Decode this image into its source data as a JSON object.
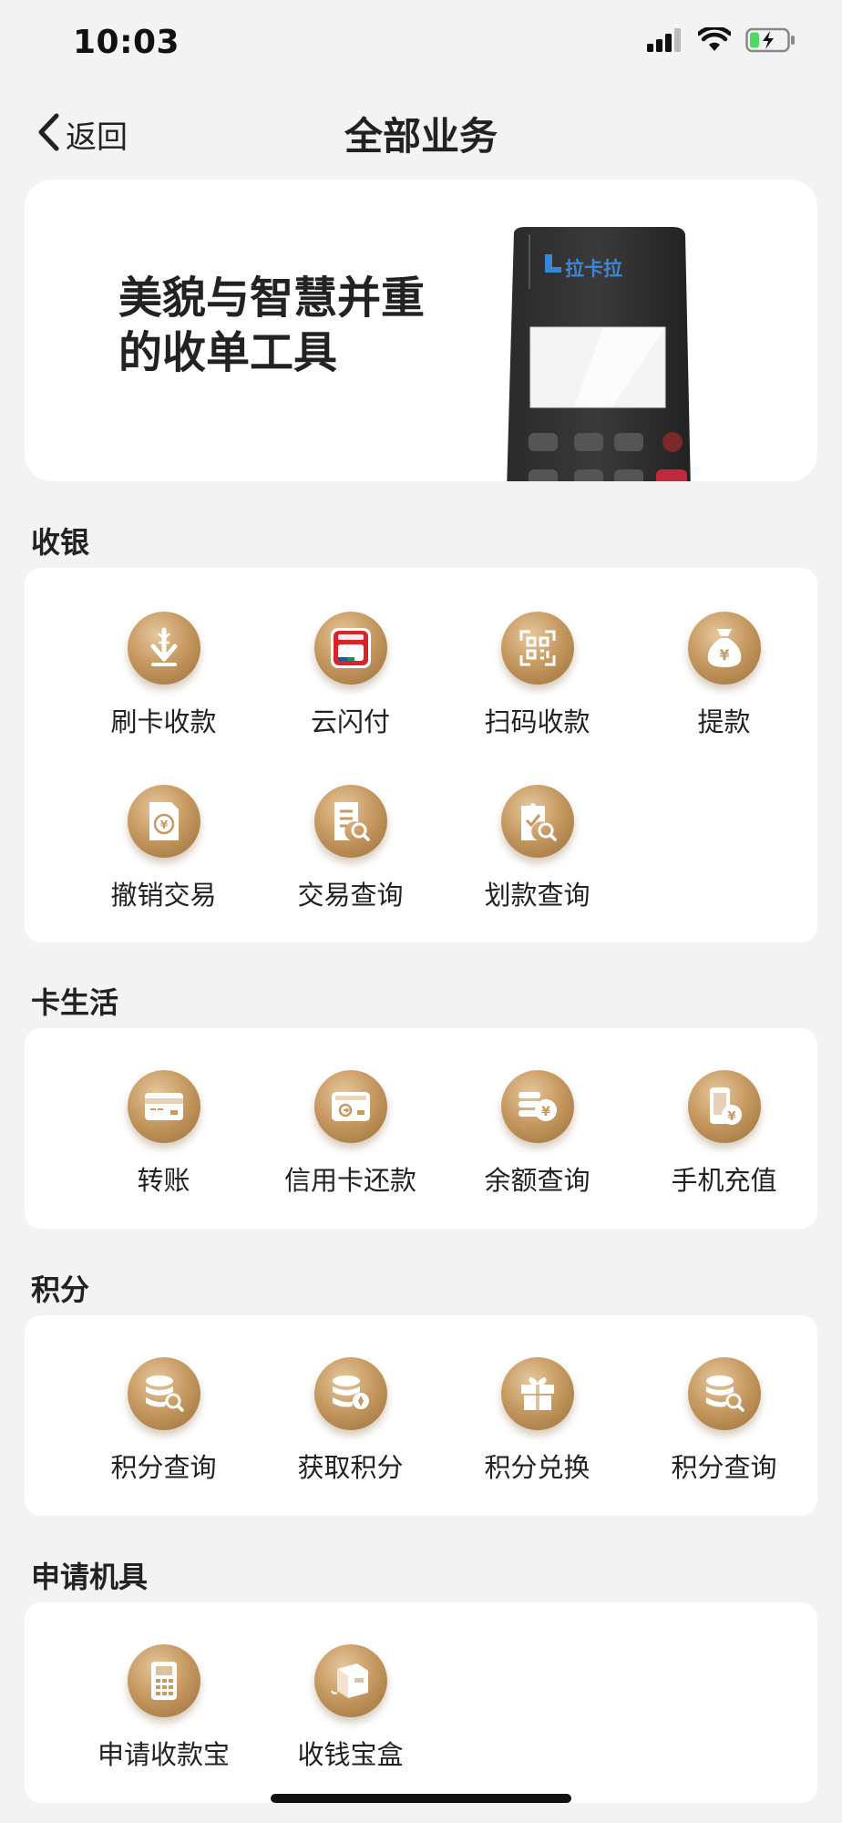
{
  "status_bar": {
    "time": "10:03",
    "signal_icon": "cellular-signal-icon",
    "wifi_icon": "wifi-icon",
    "battery_icon": "battery-charging-icon"
  },
  "nav": {
    "back_label": "返回",
    "back_icon": "chevron-left-icon",
    "title": "全部业务"
  },
  "banner": {
    "headline_line1": "美貌与智慧并重",
    "headline_line2": "的收单工具",
    "device_brand": "拉卡拉"
  },
  "colors": {
    "background": "#f3f3f3",
    "card": "#ffffff",
    "icon_gold": "#c79a62",
    "brand_blue": "#3b86d8"
  },
  "sections": [
    {
      "title": "收银",
      "items": [
        {
          "label": "刷卡收款",
          "icon": "card-payment-icon"
        },
        {
          "label": "云闪付",
          "icon": "unionpay-quickpass-icon"
        },
        {
          "label": "扫码收款",
          "icon": "qr-scan-icon"
        },
        {
          "label": "提款",
          "icon": "money-bag-icon"
        },
        {
          "label": "撤销交易",
          "icon": "revoke-transaction-icon"
        },
        {
          "label": "交易查询",
          "icon": "transaction-search-icon"
        },
        {
          "label": "划款查询",
          "icon": "transfer-search-icon"
        }
      ]
    },
    {
      "title": "卡生活",
      "items": [
        {
          "label": "转账",
          "icon": "transfer-card-icon"
        },
        {
          "label": "信用卡还款",
          "icon": "credit-card-repay-icon"
        },
        {
          "label": "余额查询",
          "icon": "balance-query-icon"
        },
        {
          "label": "手机充值",
          "icon": "mobile-recharge-icon"
        }
      ]
    },
    {
      "title": "积分",
      "items": [
        {
          "label": "积分查询",
          "icon": "points-search-icon"
        },
        {
          "label": "获取积分",
          "icon": "points-earn-icon"
        },
        {
          "label": "积分兑换",
          "icon": "gift-box-icon"
        },
        {
          "label": "积分查询",
          "icon": "points-search-icon"
        }
      ]
    },
    {
      "title": "申请机具",
      "items": [
        {
          "label": "申请收款宝",
          "icon": "pos-terminal-icon"
        },
        {
          "label": "收钱宝盒",
          "icon": "payment-box-icon"
        }
      ]
    }
  ]
}
